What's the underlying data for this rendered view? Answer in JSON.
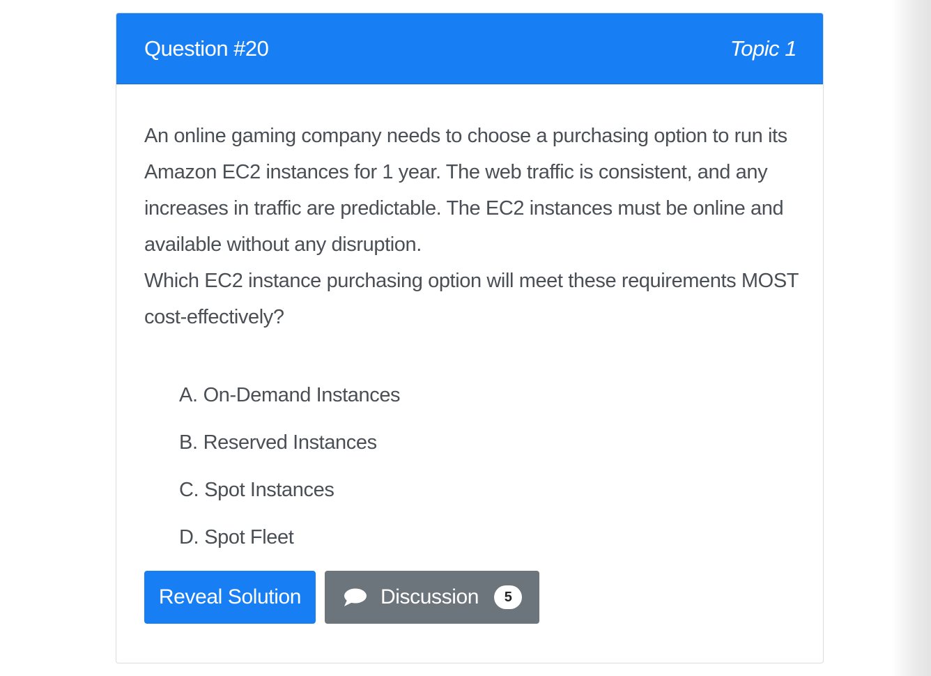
{
  "question": {
    "title": "Question #20",
    "topic": "Topic 1",
    "text_lines": [
      "An online gaming company needs to choose a purchasing option to run its Amazon EC2 instances for 1 year. The web traffic is consistent, and any increases in traffic are predictable. The EC2 instances must be online and available without any disruption.",
      "Which EC2 instance purchasing option will meet these requirements MOST cost-effectively?"
    ],
    "choices": [
      {
        "letter": "A.",
        "text": "On-Demand Instances"
      },
      {
        "letter": "B.",
        "text": "Reserved Instances"
      },
      {
        "letter": "C.",
        "text": "Spot Instances"
      },
      {
        "letter": "D.",
        "text": "Spot Fleet"
      }
    ]
  },
  "actions": {
    "reveal_label": "Reveal Solution",
    "discussion_label": "Discussion",
    "discussion_count": "5",
    "discussion_icon": "chat-bubble-icon"
  },
  "colors": {
    "primary": "#187ef4",
    "secondary": "#6c747c",
    "text": "#4a4f55"
  }
}
